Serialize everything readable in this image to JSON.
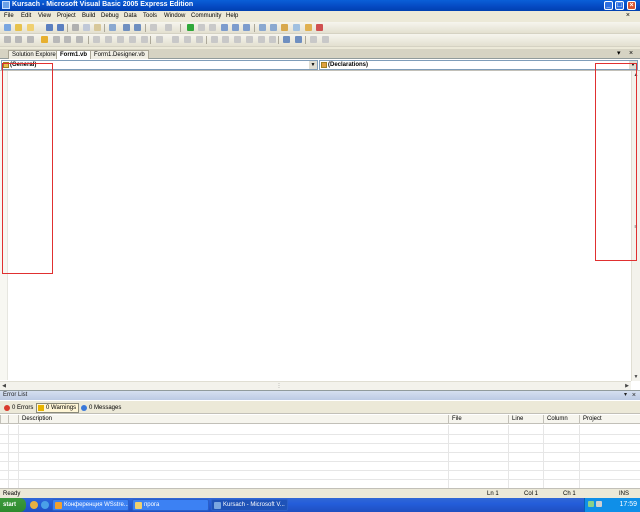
{
  "window": {
    "title": "Kursach - Microsoft Visual Basic 2005 Express Edition",
    "controls": {
      "minimize": "_",
      "maximize": "□",
      "close": "×"
    }
  },
  "menu": [
    "File",
    "Edit",
    "View",
    "Project",
    "Build",
    "Debug",
    "Data",
    "Tools",
    "Window",
    "Community",
    "Help"
  ],
  "tabs": [
    {
      "label": "Solution Explorer",
      "active": false
    },
    {
      "label": "Form1.vb",
      "active": true
    },
    {
      "label": "Form1.Designer.vb",
      "active": false
    }
  ],
  "tab_controls": {
    "pin": "▾",
    "close": "×"
  },
  "editor": {
    "class_combo": "(General)",
    "method_combo": "(Declarations)"
  },
  "error_list": {
    "title": "Error List",
    "filters": [
      {
        "label": "0 Errors",
        "icon": "error-icon",
        "color": "#D93A2B",
        "pressed": false
      },
      {
        "label": "0 Warnings",
        "icon": "warning-icon",
        "color": "#E8B400",
        "pressed": true
      },
      {
        "label": "0 Messages",
        "icon": "info-icon",
        "color": "#3A78D9",
        "pressed": false
      }
    ],
    "columns": [
      "Description",
      "File",
      "Line",
      "Column",
      "Project"
    ]
  },
  "status": {
    "text": "Ready",
    "ln": "Ln 1",
    "col": "Col 1",
    "ch": "Ch 1",
    "mode": "INS"
  },
  "taskbar": {
    "start": "start",
    "tasks": [
      {
        "label": "Конференция WSstre...",
        "active": false
      },
      {
        "label": "прога",
        "active": false
      },
      {
        "label": "Kursach - Microsoft V...",
        "active": true
      }
    ],
    "clock": "17:59"
  },
  "colors": {
    "title_bar": "#0549C2",
    "annotation_red": "#E03030",
    "taskbar": "#245DDA",
    "tray": "#0F8FE8"
  }
}
